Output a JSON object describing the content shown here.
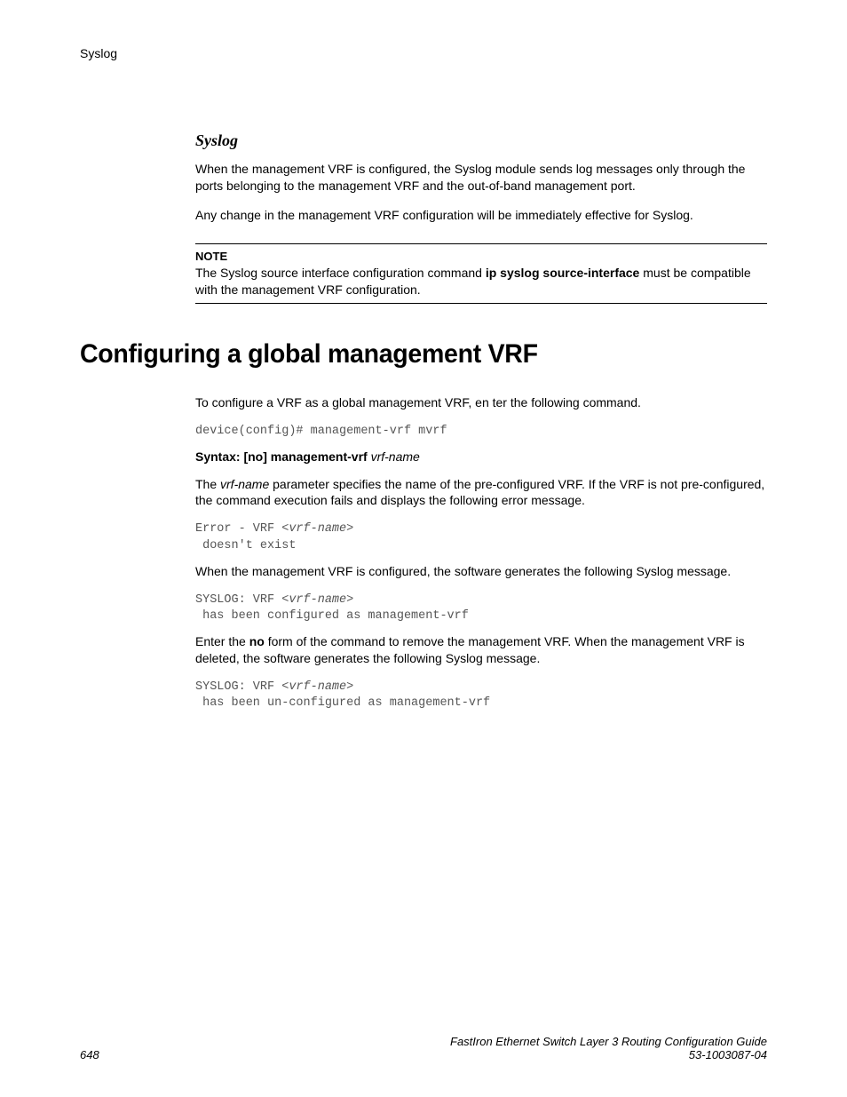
{
  "runningHeader": "Syslog",
  "section1": {
    "heading": "Syslog",
    "p1": "When the management VRF is configured, the Syslog module sends log messages only through the ports belonging to the management VRF and the out-of-band management port.",
    "p2": "Any change in the management VRF configuration will be immediately effective for Syslog.",
    "note": {
      "label": "NOTE",
      "pre": "The Syslog source interface configuration command ",
      "bold": "ip syslog source-interface",
      "post": " must be compatible with the management VRF configuration."
    }
  },
  "section2": {
    "heading": "Configuring a global management VRF",
    "p1": "To configure a VRF as a global management VRF, en ter the following command.",
    "code1": "device(config)# management-vrf mvrf",
    "syntax": {
      "bold": "Syntax: [no] management-vrf",
      "italic": " vrf-name"
    },
    "p2_pre": "The ",
    "p2_italic": "vrf-name",
    "p2_post": " parameter specifies the name of the pre-configured VRF. If the VRF is not pre-configured, the command execution fails and displays the following error message.",
    "code2_a": "Error - VRF ",
    "code2_b": "<vrf-name>",
    "code2_c": "\n doesn't exist",
    "p3": "When the management VRF is configured, the software generates the following Syslog message.",
    "code3_a": "SYSLOG: VRF ",
    "code3_b": "<vrf-name>",
    "code3_c": "\n has been configured as management-vrf",
    "p4_pre": "Enter the ",
    "p4_bold": "no",
    "p4_post": " form of the command to remove the management VRF. When the management VRF is deleted, the software generates the following Syslog message.",
    "code4_a": "SYSLOG: VRF ",
    "code4_b": "<vrf-name>",
    "code4_c": "\n has been un-configured as management-vrf"
  },
  "footer": {
    "pageNum": "648",
    "title": "FastIron Ethernet Switch Layer 3 Routing Configuration Guide",
    "docnum": "53-1003087-04"
  }
}
